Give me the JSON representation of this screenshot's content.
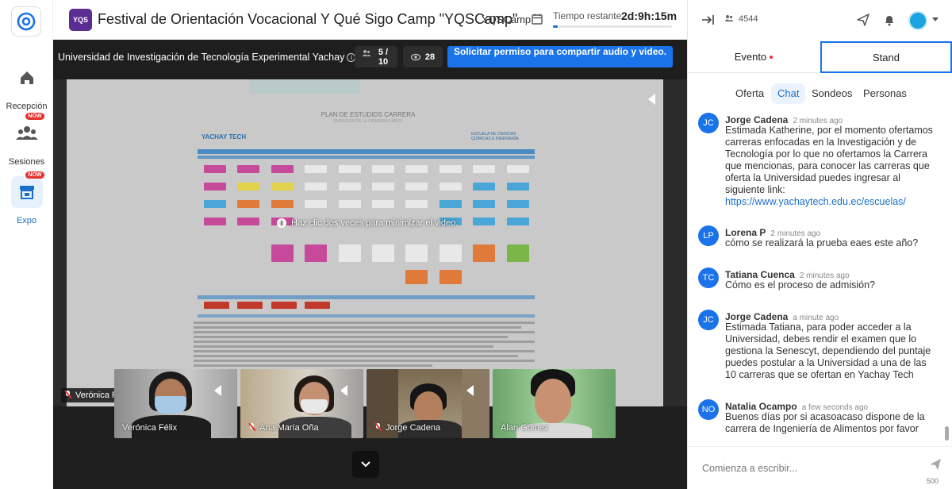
{
  "nav": {
    "items": [
      {
        "label": "Recepción",
        "icon": "home-icon"
      },
      {
        "label": "Sesiones",
        "icon": "sessions-icon",
        "badge": "NOW"
      },
      {
        "label": "Expo",
        "icon": "expo-icon",
        "badge": "NOW",
        "active": true
      }
    ]
  },
  "header": {
    "logo_text": "YQS",
    "title": "Festival de Orientación Vocacional Y Qué Sigo Camp \"YQSCamp\"",
    "code": "YQSCamp",
    "time_label": "Tiempo restante",
    "time_value": "2d:9h:15m"
  },
  "stage": {
    "room_name": "Universidad de Investigación de Tecnología Experimental Yachay",
    "people_count": "5 / 10",
    "views": "28",
    "share_button": "Solicitar permiso para compartir audio y video.",
    "overlay_hint": "Haz clic dos veces para minimizar el video.",
    "presenter": "Verónica Félix [Pantalla compartida]",
    "slide_title": "PLAN DE ESTUDIOS CARRERA",
    "slide_subtitle": "DURACIÓN DE LA CARRERA 5 AÑOS",
    "uni_logo": "YACHAY TECH",
    "school_logo": "ESCUELA DE CIENCIAS QUÍMICAS E INGENIERÍA",
    "participants": [
      {
        "name": "Verónica Félix",
        "muted": false
      },
      {
        "name": "Ana María Oña",
        "muted": true
      },
      {
        "name": "Jorge Cadena",
        "muted": true
      },
      {
        "name": "Alan Gómez",
        "muted": false
      }
    ]
  },
  "right": {
    "attendees": "4544",
    "tabs": {
      "evento": "Evento",
      "stand": "Stand"
    },
    "subtabs": [
      "Oferta",
      "Chat",
      "Sondeos",
      "Personas"
    ],
    "messages": [
      {
        "initials": "JC",
        "author": "Jorge Cadena",
        "time": "2 minutes ago",
        "text": "Estimada Katherine, por el momento ofertamos carreras enfocadas en la Investigación y de Tecnología por lo que no ofertamos la Carrera que mencionas, para conocer las carreras que oferta la Universidad puedes ingresar al siguiente link:",
        "link": "https://www.yachaytech.edu.ec/escuelas/"
      },
      {
        "initials": "LP",
        "author": "Lorena P",
        "time": "2 minutes ago",
        "text": "cómo se realizará la prueba eaes este año?"
      },
      {
        "initials": "TC",
        "author": "Tatiana Cuenca",
        "time": "2 minutes ago",
        "text": "Cómo es el proceso de admisión?"
      },
      {
        "initials": "JC",
        "author": "Jorge Cadena",
        "time": "a minute ago",
        "text": "Estimada Tatiana, para poder acceder a la Universidad, debes rendir el examen que lo gestiona la Senescyt, dependiendo del puntaje puedes postular a la Universidad a una de las 10 carreras que se ofertan en Yachay Tech"
      },
      {
        "initials": "NO",
        "author": "Natalia Ocampo",
        "time": "a few seconds ago",
        "text": "Buenos días por si acasoacaso dispone de la carrera de Ingeniería de Alimentos por favor"
      }
    ],
    "composer": {
      "placeholder": "Comienza a escribir...",
      "char_count": "500"
    }
  },
  "colors": {
    "accent": "#1a73e8",
    "brand": "#5b2d91",
    "badge": "#e5322d"
  }
}
